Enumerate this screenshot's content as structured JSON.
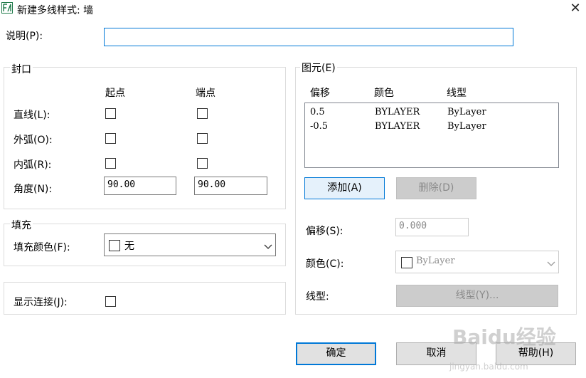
{
  "window": {
    "title": "新建多线样式: 墙",
    "close": "✕"
  },
  "description": {
    "label": "说明(P):",
    "value": ""
  },
  "caps": {
    "group_label": "封口",
    "col_start": "起点",
    "col_end": "端点",
    "rows": [
      {
        "label": "直线(L):",
        "start_checked": false,
        "end_checked": false
      },
      {
        "label": "外弧(O):",
        "start_checked": false,
        "end_checked": false
      },
      {
        "label": "内弧(R):",
        "start_checked": false,
        "end_checked": false
      }
    ],
    "angle_label": "角度(N):",
    "angle_start": "90.00",
    "angle_end": "90.00"
  },
  "fill": {
    "group_label": "填充",
    "color_label": "填充颜色(F):",
    "color_value": "无"
  },
  "display_joints": {
    "label": "显示连接(J):",
    "checked": false
  },
  "elements": {
    "group_label": "图元(E)",
    "headers": {
      "offset": "偏移",
      "color": "颜色",
      "linetype": "线型"
    },
    "rows": [
      {
        "offset": "0.5",
        "color": "BYLAYER",
        "linetype": "ByLayer"
      },
      {
        "offset": "-0.5",
        "color": "BYLAYER",
        "linetype": "ByLayer"
      }
    ],
    "add_label": "添加(A)",
    "delete_label": "删除(D)",
    "offset_label": "偏移(S):",
    "offset_value": "0.000",
    "color_label": "颜色(C):",
    "color_value": "ByLayer",
    "linetype_label": "线型:",
    "linetype_button": "线型(Y)..."
  },
  "footer": {
    "ok": "确定",
    "cancel": "取消",
    "help": "帮助(H)"
  },
  "watermark": {
    "text": "Baidu经验",
    "sub": "jingyan.baidu.com"
  }
}
